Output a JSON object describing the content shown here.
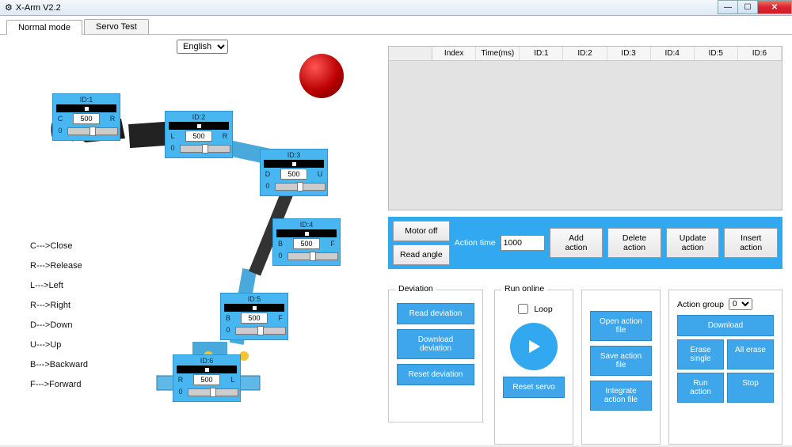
{
  "window": {
    "title": "X-Arm V2.2"
  },
  "tabs": {
    "normal": "Normal mode",
    "servo": "Servo Test"
  },
  "language": {
    "selected": "English"
  },
  "servos": [
    {
      "id": "ID:1",
      "value": "500",
      "zero": "0",
      "leftLetter": "C",
      "rightLetter": "R"
    },
    {
      "id": "ID:2",
      "value": "500",
      "zero": "0",
      "leftLetter": "L",
      "rightLetter": "R"
    },
    {
      "id": "ID:3",
      "value": "500",
      "zero": "0",
      "leftLetter": "D",
      "rightLetter": "U"
    },
    {
      "id": "ID:4",
      "value": "500",
      "zero": "0",
      "leftLetter": "B",
      "rightLetter": "F"
    },
    {
      "id": "ID:5",
      "value": "500",
      "zero": "0",
      "leftLetter": "B",
      "rightLetter": "F"
    },
    {
      "id": "ID:6",
      "value": "500",
      "zero": "0",
      "leftLetter": "R",
      "rightLetter": "L"
    }
  ],
  "legend": {
    "c": "C--->Close",
    "r": "R--->Release",
    "l": "L--->Left",
    "r2": "R--->Right",
    "d": "D--->Down",
    "u": "U--->Up",
    "b": "B--->Backward",
    "f": "F--->Forward"
  },
  "grid_headers": {
    "idx": "Index",
    "time": "Time(ms)",
    "id1": "ID:1",
    "id2": "ID:2",
    "id3": "ID:3",
    "id4": "ID:4",
    "id5": "ID:5",
    "id6": "ID:6"
  },
  "toolbar": {
    "motor_off": "Motor off",
    "read_angle": "Read angle",
    "action_time_lbl": "Action time",
    "action_time_val": "1000",
    "add": "Add action",
    "delete": "Delete action",
    "update": "Update action",
    "insert": "Insert action"
  },
  "deviation": {
    "title": "Deviation",
    "read": "Read deviation",
    "download": "Download deviation",
    "reset": "Reset deviation"
  },
  "run": {
    "title": "Run online",
    "loop": "Loop",
    "reset_servo": "Reset servo"
  },
  "file": {
    "open": "Open action file",
    "save": "Save action file",
    "integrate": "Integrate action file"
  },
  "action_group": {
    "label": "Action group",
    "value": "0",
    "download": "Download",
    "erase_single": "Erase single",
    "all_erase": "All erase",
    "run": "Run action",
    "stop": "Stop"
  }
}
